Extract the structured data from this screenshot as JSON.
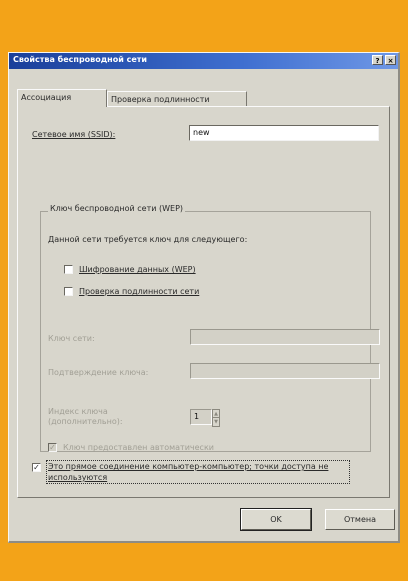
{
  "window": {
    "title": "Свойства беспроводной сети",
    "help_button": "?",
    "close_button": "×"
  },
  "tabs": [
    {
      "label": "Ассоциация",
      "active": true
    },
    {
      "label": "Проверка подлинности",
      "active": false
    }
  ],
  "ssid": {
    "label": "Сетевое имя (SSID):",
    "value": "new"
  },
  "wep_group": {
    "label": "Ключ беспроводной сети (WEP)",
    "description": "Данной сети требуется ключ для следующего:",
    "data_encryption": {
      "label": "Шифрование данных (WEP)",
      "checked": false
    },
    "network_auth": {
      "label": "Проверка подлинности сети",
      "checked": false
    },
    "network_key": {
      "label": "Ключ сети:",
      "value": ""
    },
    "confirm_key": {
      "label": "Подтверждение ключа:",
      "value": ""
    },
    "key_index": {
      "label": "Индекс ключа (дополнительно):",
      "value": "1"
    },
    "auto_key": {
      "label": "Ключ предоставлен автоматически",
      "checked": true
    }
  },
  "adhoc": {
    "label": "Это прямое соединение компьютер-компьютер; точки доступа не используются",
    "checked": true
  },
  "buttons": {
    "ok": "OK",
    "cancel": "Отмена"
  },
  "colors": {
    "frame": "#f3a318",
    "dialog": "#d8d6cc",
    "titlebar": "#2a56b8"
  }
}
